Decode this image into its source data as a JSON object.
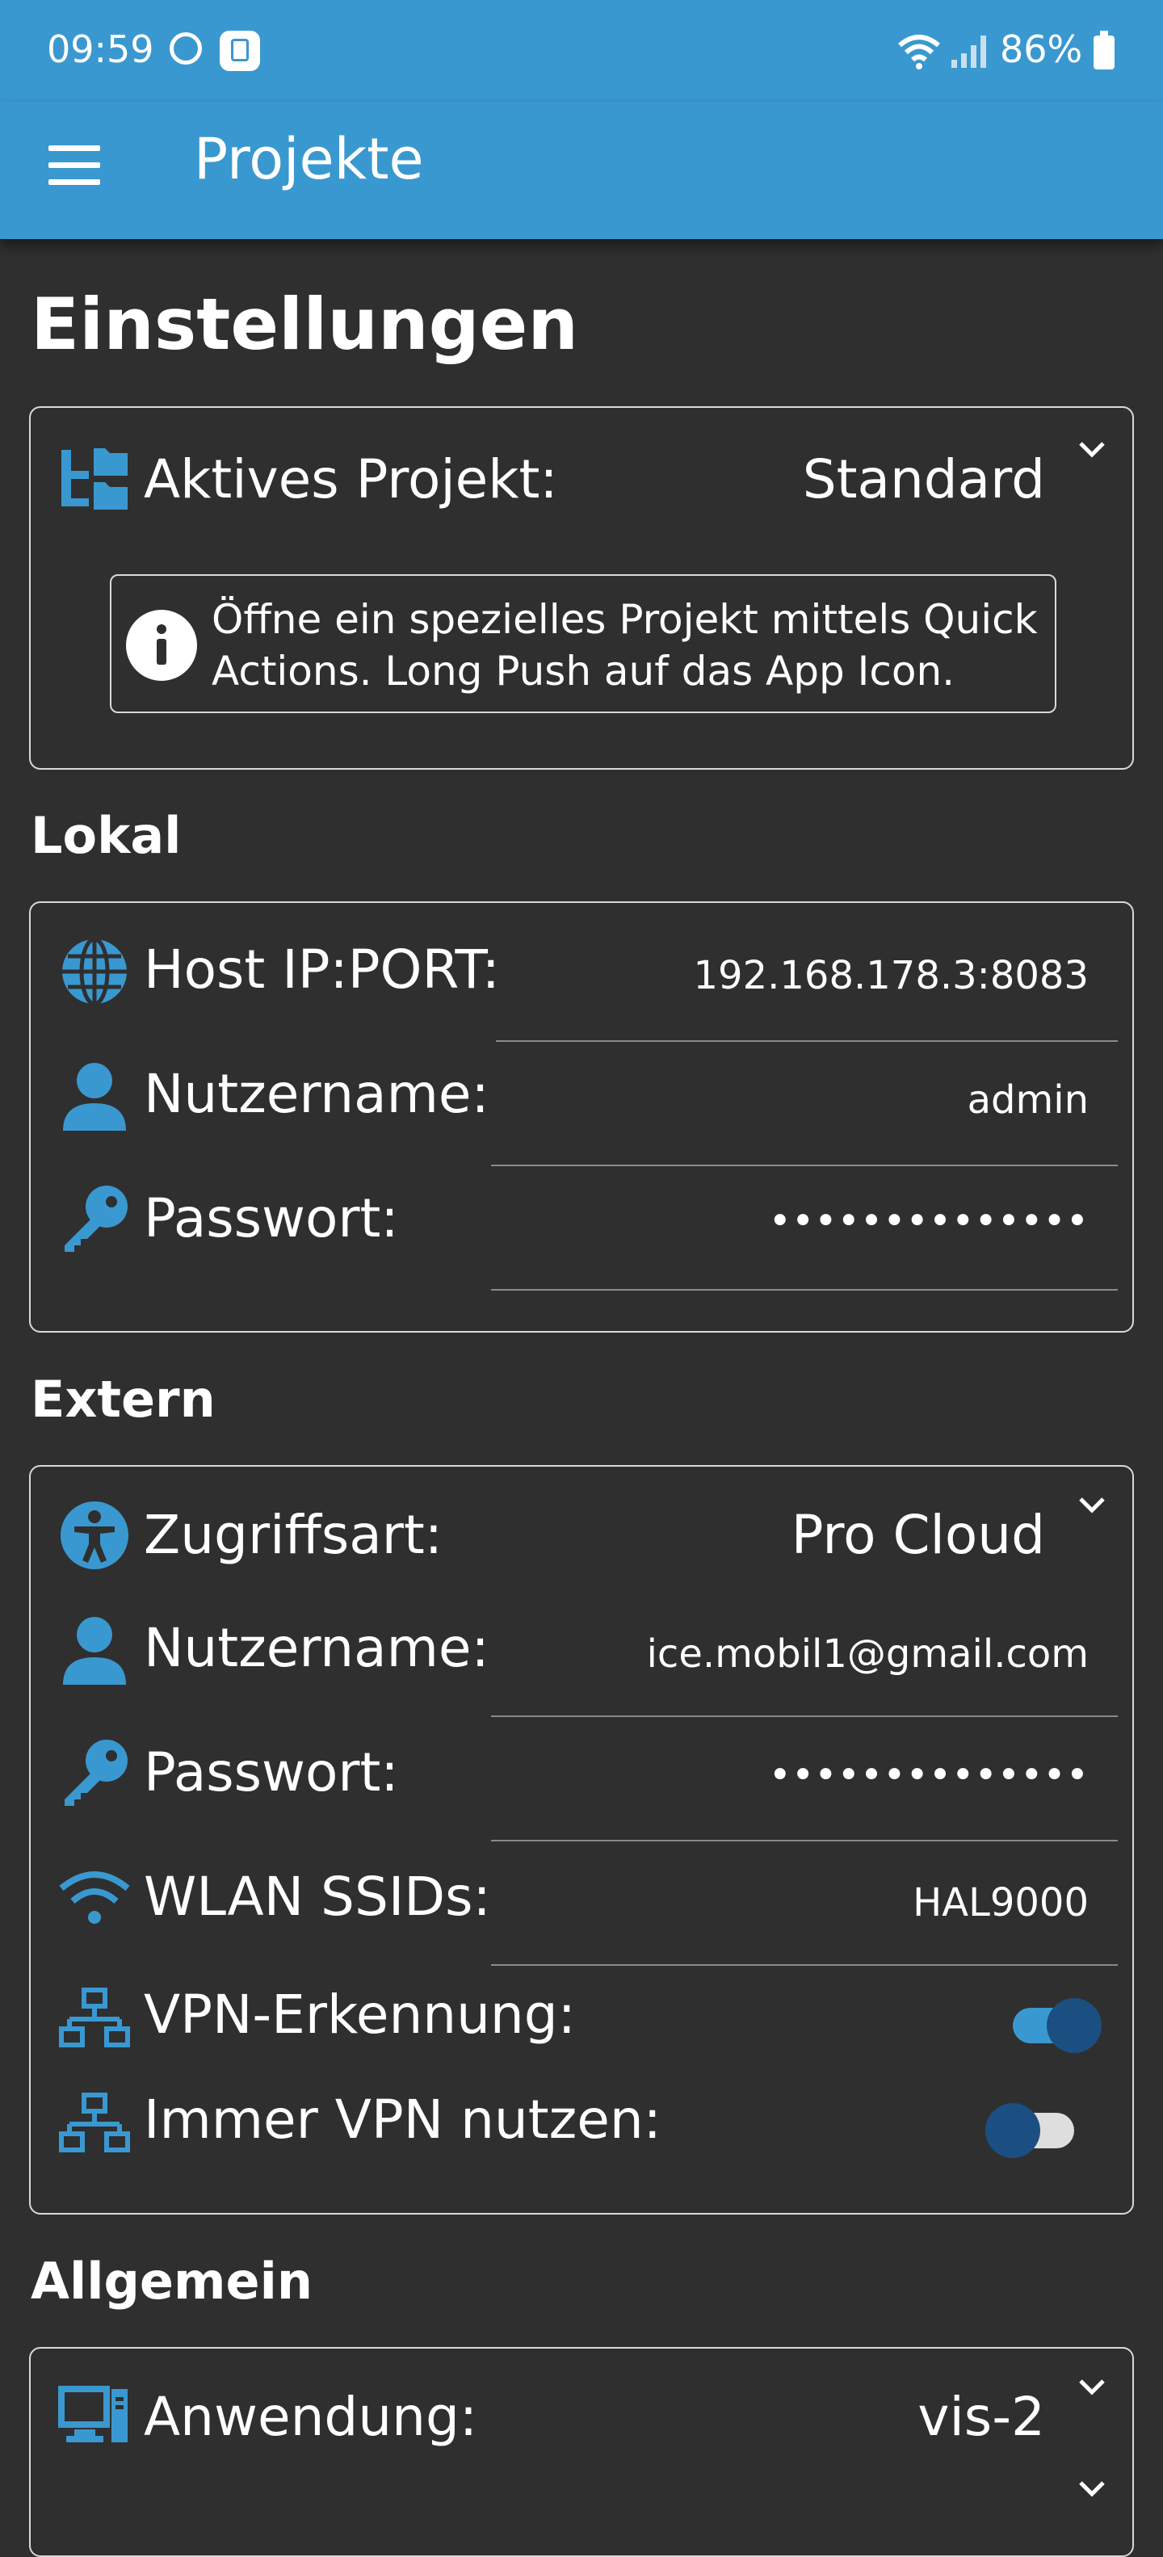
{
  "status_bar": {
    "time": "09:59",
    "battery": "86%"
  },
  "app_bar": {
    "title": "Projekte",
    "menu_icon": "hamburger-menu-icon"
  },
  "page": {
    "title": "Einstellungen"
  },
  "active_project": {
    "label": "Aktives Projekt:",
    "value": "Standard",
    "icon": "folder-tree-icon",
    "info_text": "Öffne ein spezielles Projekt mittels Quick Actions. Long Push auf das App Icon."
  },
  "lokal": {
    "heading": "Lokal",
    "host": {
      "label": "Host IP:PORT:",
      "value": "192.168.178.3:8083"
    },
    "username": {
      "label": "Nutzername:",
      "value": "admin"
    },
    "password": {
      "label": "Passwort:",
      "value": "••••••••••••••"
    }
  },
  "extern": {
    "heading": "Extern",
    "access": {
      "label": "Zugriffsart:",
      "value": "Pro Cloud"
    },
    "username": {
      "label": "Nutzername:",
      "value": "ice.mobil1@gmail.com"
    },
    "password": {
      "label": "Passwort:",
      "value": "••••••••••••••"
    },
    "wlan": {
      "label": "WLAN SSIDs:",
      "value": "HAL9000"
    },
    "vpn_detect": {
      "label": "VPN-Erkennung:",
      "enabled": true
    },
    "vpn_always": {
      "label": "Immer VPN nutzen:",
      "enabled": false
    }
  },
  "allgemein": {
    "heading": "Allgemein",
    "application": {
      "label": "Anwendung:",
      "value": "vis-2"
    }
  },
  "colors": {
    "accent": "#3a98d0",
    "background": "#2f2f2f",
    "toggle_knob": "#1b4f82"
  }
}
